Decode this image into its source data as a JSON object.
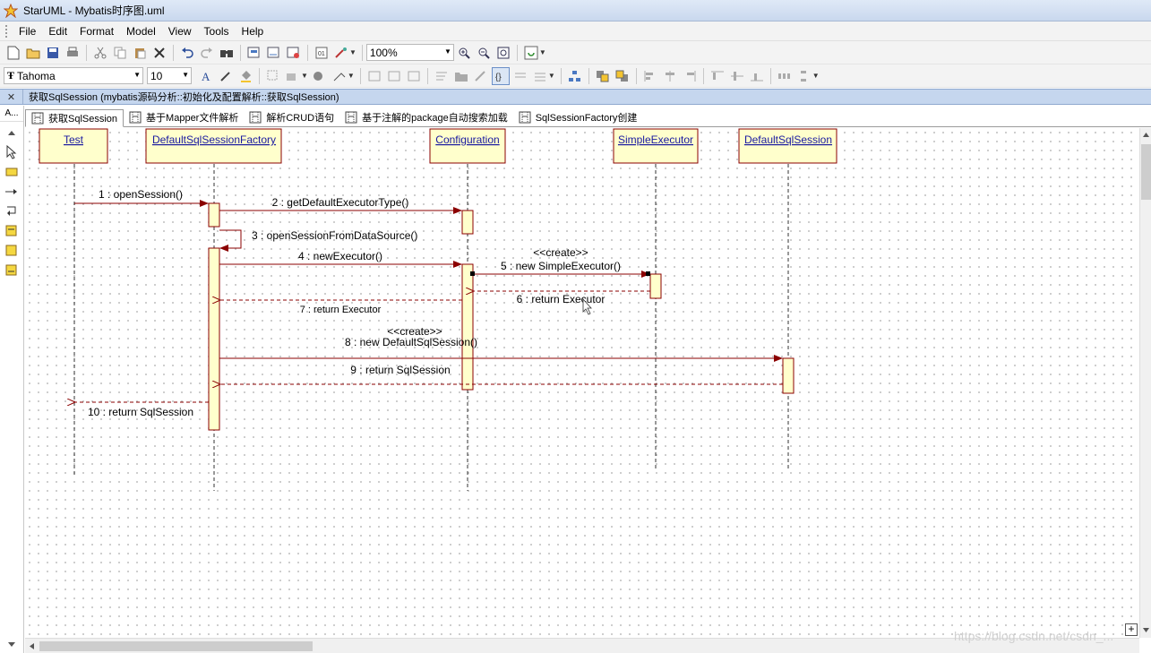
{
  "window": {
    "title": "StarUML - Mybatis时序图.uml"
  },
  "menu": [
    "File",
    "Edit",
    "Format",
    "Model",
    "View",
    "Tools",
    "Help"
  ],
  "toolbar": {
    "zoom": "100%",
    "font": "Tahoma",
    "font_size": "10"
  },
  "document": {
    "title": "获取SqlSession (mybatis源码分析::初始化及配置解析::获取SqlSession)",
    "close": "✕"
  },
  "palette": {
    "header": "A..."
  },
  "tabs": [
    {
      "label": "获取SqlSession",
      "active": true
    },
    {
      "label": "基于Mapper文件解析"
    },
    {
      "label": "解析CRUD语句"
    },
    {
      "label": "基于注解的package自动搜索加载"
    },
    {
      "label": "SqlSessionFactory创建"
    }
  ],
  "diagram": {
    "lifelines": [
      "Test",
      "DefaultSqlSessionFactory",
      "Configuration",
      "SimpleExecutor",
      "DefaultSqlSession"
    ],
    "messages": [
      {
        "label": "1 : openSession()"
      },
      {
        "label": "2 : getDefaultExecutorType()"
      },
      {
        "label": "3 : openSessionFromDataSource()"
      },
      {
        "label": "4 : newExecutor()"
      },
      {
        "label": "5 : new SimpleExecutor()",
        "stereotype": "<<create>>"
      },
      {
        "label": "6 : return Executor"
      },
      {
        "label": "7 : return Executor"
      },
      {
        "label": "8 : new DefaultSqlSession()",
        "stereotype": "<<create>>"
      },
      {
        "label": "9 : return SqlSession"
      },
      {
        "label": "10 : return SqlSession"
      }
    ]
  },
  "watermark": "https://blog.csdn.net/csdn_...",
  "colors": {
    "lifeline_fill": "#ffffcc",
    "lifeline_border": "#8b0000",
    "message": "#8b0000",
    "title_bg": "#c5d6ee"
  }
}
